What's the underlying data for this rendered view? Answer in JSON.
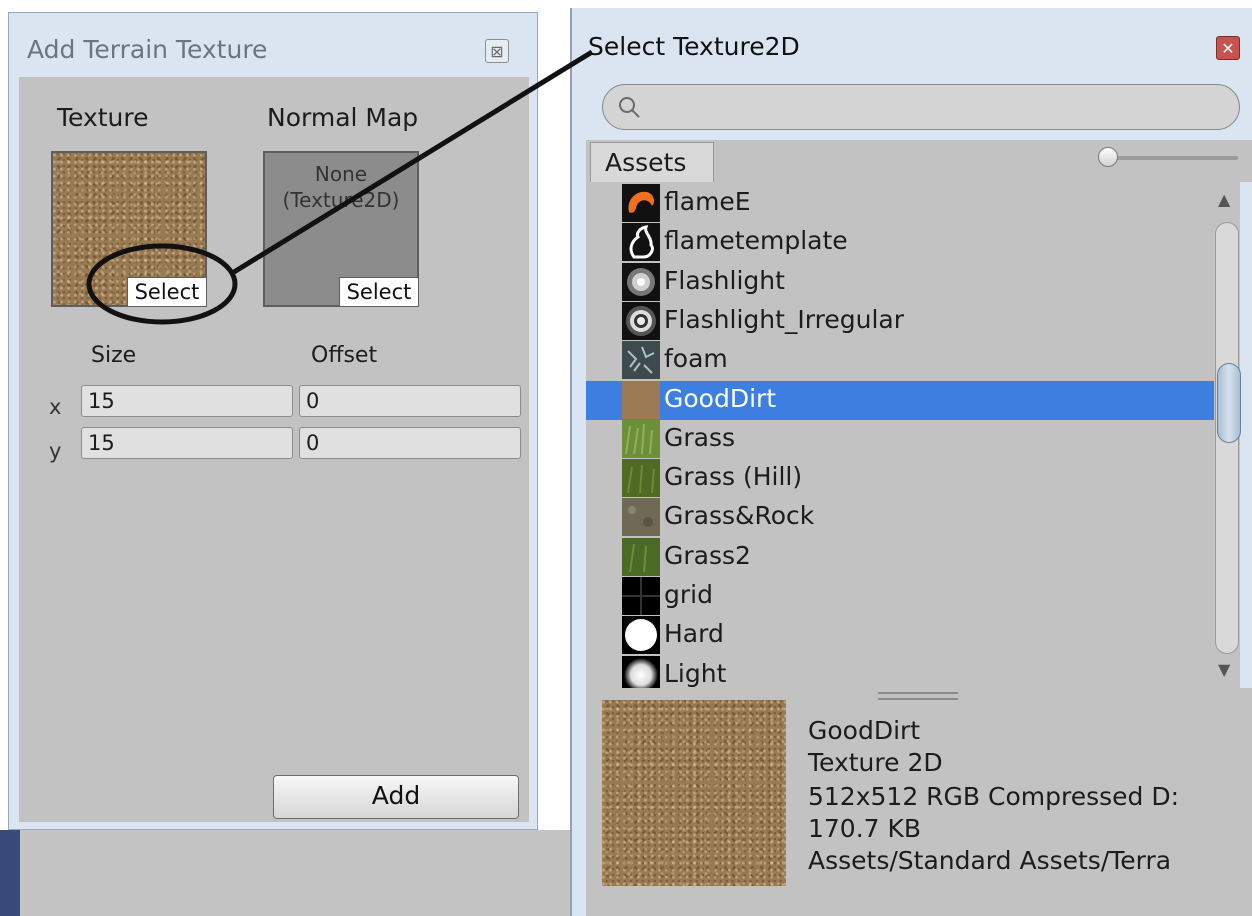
{
  "left_window": {
    "title": "Add Terrain Texture",
    "close_glyph": "⊠",
    "texture_label": "Texture",
    "normal_map_label": "Normal Map",
    "normal_map_none_line1": "None",
    "normal_map_none_line2": "(Texture2D)",
    "select_label": "Select",
    "size_label": "Size",
    "offset_label": "Offset",
    "x_label": "x",
    "y_label": "y",
    "size_x": "15",
    "size_y": "15",
    "offset_x": "0",
    "offset_y": "0",
    "add_label": "Add"
  },
  "right_window": {
    "title": "Select Texture2D",
    "close_glyph": "✕",
    "search_placeholder": "",
    "tab_label": "Assets",
    "items": [
      {
        "name": "flameE",
        "icon": "flame-orange-icon"
      },
      {
        "name": "flametemplate",
        "icon": "flame-outline-icon"
      },
      {
        "name": "Flashlight",
        "icon": "flashlight-icon"
      },
      {
        "name": "Flashlight_Irregular",
        "icon": "flashlight-irregular-icon"
      },
      {
        "name": "foam",
        "icon": "foam-icon"
      },
      {
        "name": "GoodDirt",
        "icon": "dirt-icon",
        "selected": true
      },
      {
        "name": "Grass",
        "icon": "grass-icon"
      },
      {
        "name": "Grass (Hill)",
        "icon": "grass-hill-icon"
      },
      {
        "name": "Grass&Rock",
        "icon": "grass-rock-icon"
      },
      {
        "name": "Grass2",
        "icon": "grass2-icon"
      },
      {
        "name": "grid",
        "icon": "grid-icon"
      },
      {
        "name": "Hard",
        "icon": "hard-brush-icon"
      },
      {
        "name": "Light",
        "icon": "light-brush-icon"
      }
    ],
    "preview": {
      "name": "GoodDirt",
      "type": "Texture 2D",
      "format": "512x512  RGB Compressed D:",
      "size": "170.7 KB",
      "path": "Assets/Standard Assets/Terra"
    },
    "selection_color": "#3d7fe0"
  }
}
